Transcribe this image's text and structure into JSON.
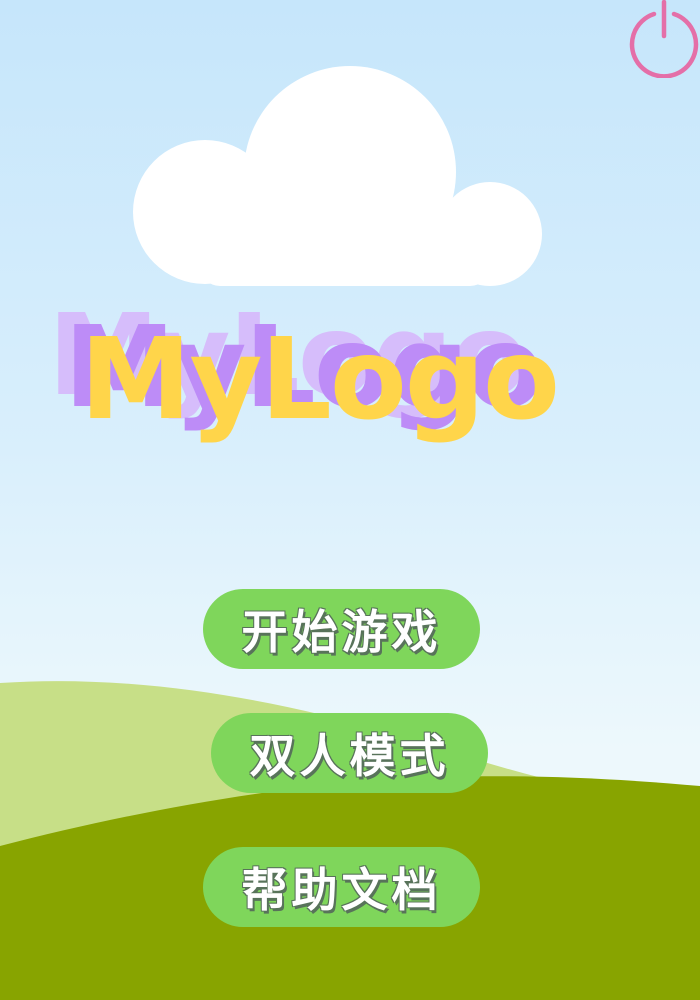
{
  "logo": {
    "text": "MyLogo"
  },
  "menu": {
    "start_label": "开始游戏",
    "duo_label": "双人模式",
    "help_label": "帮助文档"
  },
  "icons": {
    "top_right": "power-icon"
  },
  "colors": {
    "sky_top": "#c6e6fb",
    "sky_bottom": "#eef8f8",
    "hill_back": "#c7df87",
    "hill_front": "#88a400",
    "cloud": "#ffffff",
    "button": "#7fd65b",
    "logo_main": "#ffd54a",
    "logo_shadow": "#bd8cf7",
    "power_icon": "#e46fa8"
  }
}
